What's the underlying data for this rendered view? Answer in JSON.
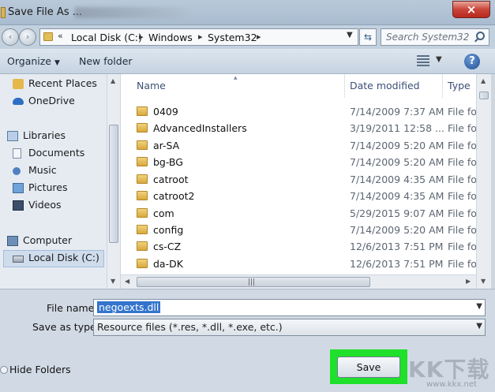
{
  "window": {
    "title": "Save File As ...",
    "close_glyph": "×"
  },
  "address": {
    "back_glyph": "‹",
    "forward_glyph": "›",
    "overflow": "«",
    "breadcrumbs": [
      "Local Disk (C:)",
      "Windows",
      "System32"
    ],
    "search_placeholder": "Search System32"
  },
  "toolbar": {
    "organize": "Organize",
    "new_folder": "New folder",
    "help_glyph": "?"
  },
  "nav": {
    "items": [
      {
        "label": "Recent Places",
        "icon": "recent-places-icon"
      },
      {
        "label": "OneDrive",
        "icon": "onedrive-icon"
      },
      {
        "label": "Libraries",
        "icon": "libraries-icon"
      },
      {
        "label": "Documents",
        "icon": "documents-icon"
      },
      {
        "label": "Music",
        "icon": "music-icon"
      },
      {
        "label": "Pictures",
        "icon": "pictures-icon"
      },
      {
        "label": "Videos",
        "icon": "videos-icon"
      },
      {
        "label": "Computer",
        "icon": "computer-icon"
      },
      {
        "label": "Local Disk (C:)",
        "icon": "local-disk-icon"
      }
    ],
    "selected": "Local Disk (C:)"
  },
  "columns": {
    "name": "Name",
    "date": "Date modified",
    "type": "Type"
  },
  "files": [
    {
      "name": "0409",
      "date": "7/14/2009 7:37 AM",
      "type": "File fold"
    },
    {
      "name": "AdvancedInstallers",
      "date": "3/19/2011 12:58 ...",
      "type": "File fold"
    },
    {
      "name": "ar-SA",
      "date": "7/14/2009 5:20 AM",
      "type": "File fold"
    },
    {
      "name": "bg-BG",
      "date": "7/14/2009 5:20 AM",
      "type": "File fold"
    },
    {
      "name": "catroot",
      "date": "7/14/2009 4:35 AM",
      "type": "File fold"
    },
    {
      "name": "catroot2",
      "date": "7/14/2009 4:35 AM",
      "type": "File fold"
    },
    {
      "name": "com",
      "date": "5/29/2015 9:07 AM",
      "type": "File fold"
    },
    {
      "name": "config",
      "date": "7/14/2009 5:20 AM",
      "type": "File fold"
    },
    {
      "name": "cs-CZ",
      "date": "12/6/2013 7:51 PM",
      "type": "File fold"
    },
    {
      "name": "da-DK",
      "date": "12/6/2013 7:51 PM",
      "type": "File fold"
    }
  ],
  "form": {
    "file_name_label": "File name:",
    "file_name_value": "negoexts.dll",
    "save_type_label": "Save as type:",
    "save_type_value": "Resource files (*.res, *.dll, *.exe, etc.)",
    "hide_folders": "Hide Folders",
    "save": "Save"
  },
  "watermark": {
    "text": "KK下载",
    "url": "www.kkx.net"
  },
  "colors": {
    "highlight": "#1fe02a",
    "selection": "#3374cc",
    "close": "#c9453a"
  }
}
